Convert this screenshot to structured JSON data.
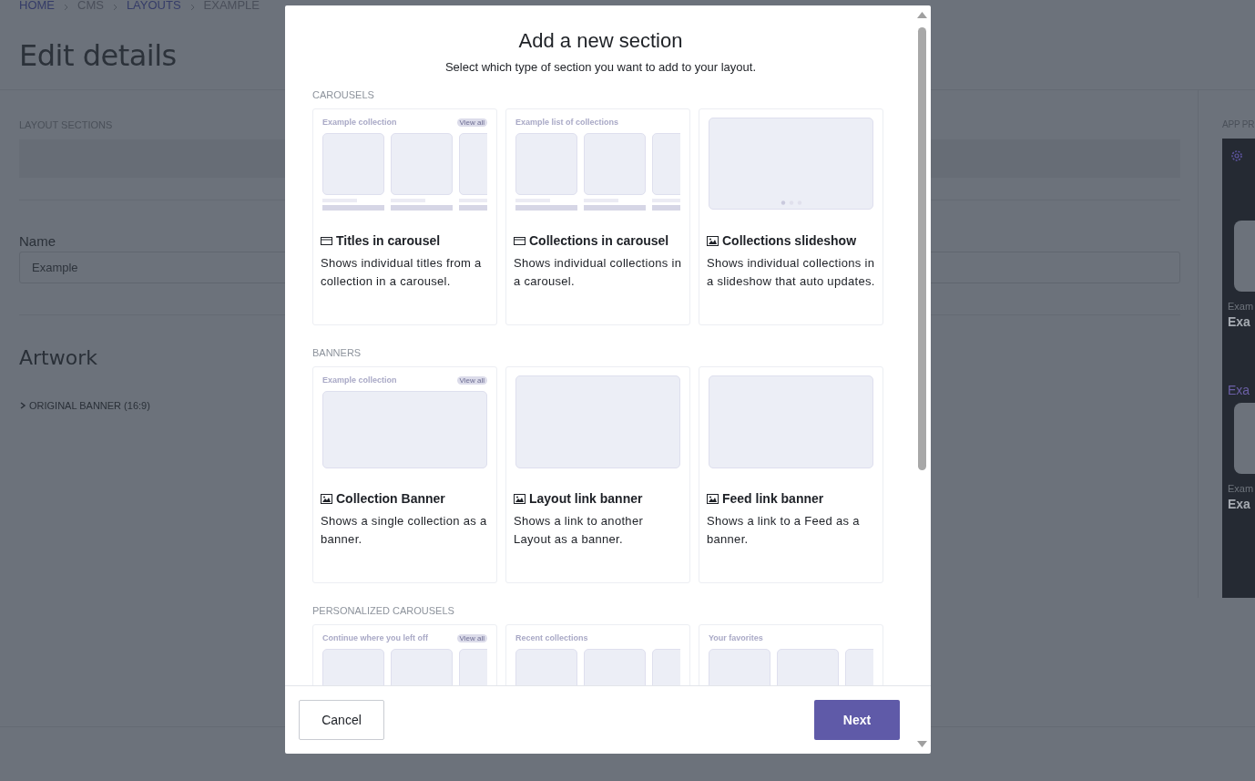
{
  "breadcrumb": [
    {
      "label": "HOME",
      "link": true
    },
    {
      "label": "CMS",
      "link": false
    },
    {
      "label": "LAYOUTS",
      "link": true
    },
    {
      "label": "EXAMPLE",
      "link": false
    }
  ],
  "page_title": "Edit details",
  "layout_sections": {
    "label": "LAYOUT SECTIONS"
  },
  "name_field": {
    "label": "Name",
    "value": "Example"
  },
  "artwork": {
    "heading": "Artwork",
    "items": [
      {
        "label": "ORIGINAL BANNER (16:9)",
        "expanded": false
      }
    ]
  },
  "app_preview": {
    "label": "APP PR",
    "rows": [
      {
        "kind": "card",
        "caption": "Exam",
        "title": "Exa"
      },
      {
        "kind": "heading",
        "text": "Exa"
      },
      {
        "kind": "card",
        "caption": "Exam",
        "title": "Exa"
      }
    ]
  },
  "dialog": {
    "title": "Add a new section",
    "subtitle": "Select which type of section you want to add to your layout.",
    "sections": [
      {
        "heading": "CAROUSELS",
        "cards": [
          {
            "title": "Titles in carousel",
            "description": "Shows individual titles from a collection in a carousel.",
            "preview": {
              "kind": "carousel",
              "caption": "Example collection",
              "badge": "View all"
            }
          },
          {
            "title": "Collections in carousel",
            "description": "Shows individual collections in a carousel.",
            "preview": {
              "kind": "carousel",
              "caption": "Example list of collections"
            }
          },
          {
            "title": "Collections slideshow",
            "description": "Shows individual collections in a slideshow that auto updates.",
            "preview": {
              "kind": "slideshow"
            }
          }
        ]
      },
      {
        "heading": "BANNERS",
        "cards": [
          {
            "title": "Collection Banner",
            "description": "Shows a single collection as a banner.",
            "preview": {
              "kind": "banner",
              "caption": "Example collection",
              "badge": "View all"
            }
          },
          {
            "title": "Layout link banner",
            "description": "Shows a link to another Layout as a banner.",
            "preview": {
              "kind": "banner"
            }
          },
          {
            "title": "Feed link banner",
            "description": "Shows a link to a Feed as a banner.",
            "preview": {
              "kind": "banner"
            }
          }
        ]
      },
      {
        "heading": "PERSONALIZED CAROUSELS",
        "cards": [
          {
            "preview": {
              "kind": "carousel",
              "caption": "Continue where you left off",
              "badge": "View all"
            }
          },
          {
            "preview": {
              "kind": "carousel",
              "caption": "Recent collections"
            }
          },
          {
            "preview": {
              "kind": "carousel",
              "caption": "Your favorites"
            }
          }
        ]
      }
    ],
    "buttons": [
      {
        "kind": "secondary",
        "label": "Cancel"
      },
      {
        "kind": "primary",
        "label": "Next"
      }
    ]
  }
}
